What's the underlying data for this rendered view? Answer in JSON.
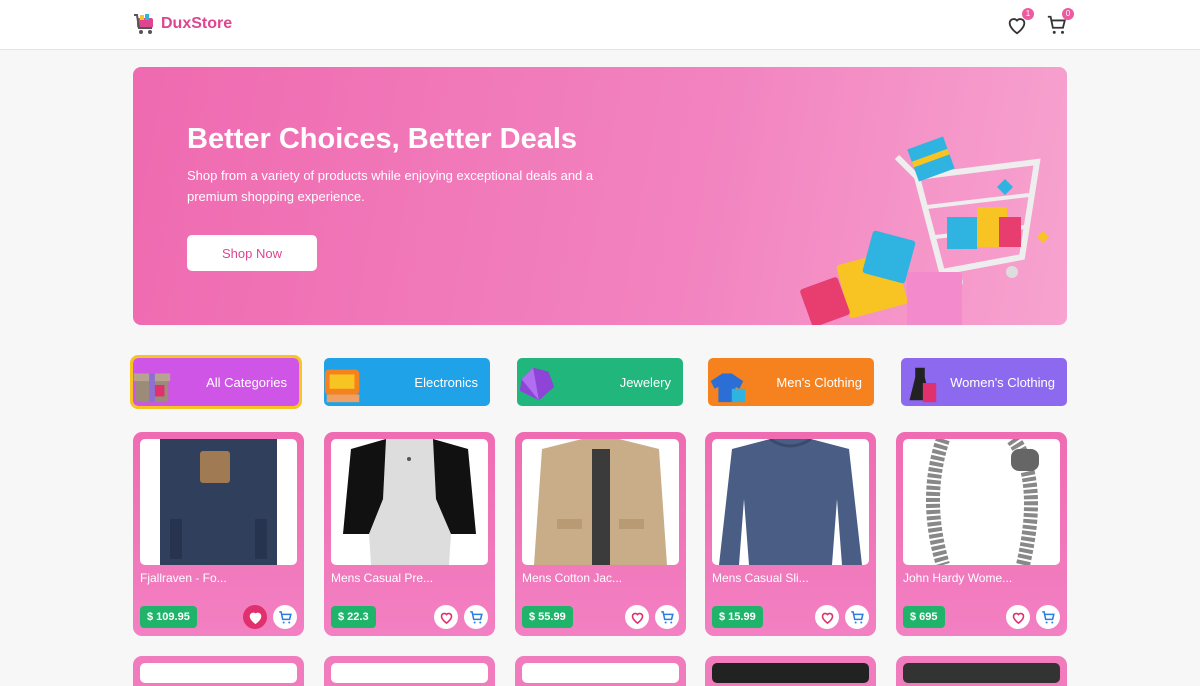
{
  "header": {
    "brand": "DuxStore",
    "wishlist_count": "1",
    "cart_count": "0"
  },
  "hero": {
    "title": "Better Choices, Better Deals",
    "subtitle": "Shop from a variety of products while enjoying exceptional deals and a premium shopping experience.",
    "button": "Shop Now"
  },
  "categories": [
    {
      "label": "All Categories",
      "icon": "gift-box-icon",
      "color": "#cf55e6",
      "active": true
    },
    {
      "label": "Electronics",
      "icon": "computer-icon",
      "color": "#1fa2e8"
    },
    {
      "label": "Jewelery",
      "icon": "gem-icon",
      "color": "#20b67c"
    },
    {
      "label": "Men's Clothing",
      "icon": "shirt-hanger-icon",
      "color": "#f5821f"
    },
    {
      "label": "Women's Clothing",
      "icon": "dress-icon",
      "color": "#8d69f0"
    }
  ],
  "products": [
    {
      "title": "Fjallraven - Fo...",
      "price": "$ 109.95",
      "favorited": true,
      "image": "backpack"
    },
    {
      "title": "Mens Casual Pre...",
      "price": "$ 22.3",
      "favorited": false,
      "image": "raglan-tshirt"
    },
    {
      "title": "Mens Cotton Jac...",
      "price": "$ 55.99",
      "favorited": false,
      "image": "jacket"
    },
    {
      "title": "Mens Casual Sli...",
      "price": "$ 15.99",
      "favorited": false,
      "image": "long-sleeve-shirt"
    },
    {
      "title": "John Hardy Wome...",
      "price": "$ 695",
      "favorited": false,
      "image": "bracelet"
    }
  ]
}
